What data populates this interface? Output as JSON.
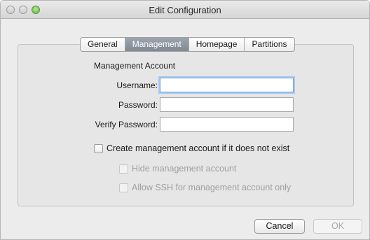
{
  "window": {
    "title": "Edit Configuration"
  },
  "tabs": [
    {
      "label": "General",
      "active": false
    },
    {
      "label": "Management",
      "active": true
    },
    {
      "label": "Homepage",
      "active": false
    },
    {
      "label": "Partitions",
      "active": false
    }
  ],
  "management": {
    "section_label": "Management Account",
    "username": {
      "label": "Username:",
      "value": ""
    },
    "password": {
      "label": "Password:",
      "value": ""
    },
    "verify_password": {
      "label": "Verify Password:",
      "value": ""
    },
    "create_account": {
      "label": "Create management account if it does not exist",
      "checked": false
    },
    "hide_account": {
      "label": "Hide management account",
      "checked": false,
      "enabled": false
    },
    "allow_ssh": {
      "label": "Allow SSH for management account only",
      "checked": false,
      "enabled": false
    }
  },
  "buttons": {
    "cancel": "Cancel",
    "ok": "OK"
  }
}
